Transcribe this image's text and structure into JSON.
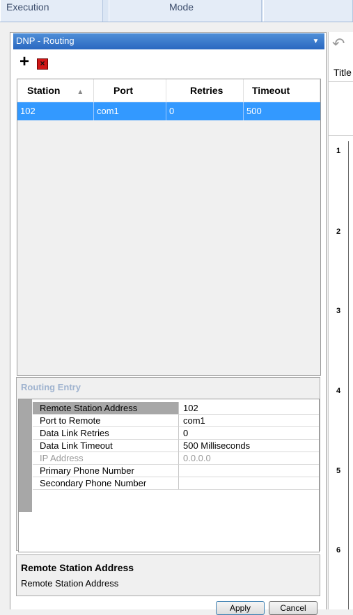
{
  "top_tabs": [
    "Execution",
    "Mode",
    ""
  ],
  "panel": {
    "title": "DNP - Routing",
    "add_label": "+",
    "delete_label": "×"
  },
  "grid": {
    "columns": [
      "Station",
      "Port",
      "Retries",
      "Timeout"
    ],
    "sort_indicator": "▲",
    "rows": [
      [
        "102",
        "com1",
        "0",
        "500"
      ]
    ]
  },
  "entry": {
    "title": "Routing Entry",
    "properties": [
      {
        "name": "Remote Station Address",
        "value": "102"
      },
      {
        "name": "Port to Remote",
        "value": "com1"
      },
      {
        "name": "Data Link Retries",
        "value": "0"
      },
      {
        "name": "Data Link Timeout",
        "value": "500 Milliseconds"
      },
      {
        "name": "IP Address",
        "value": "0.0.0.0"
      },
      {
        "name": "Primary Phone Number",
        "value": ""
      },
      {
        "name": "Secondary Phone Number",
        "value": ""
      }
    ]
  },
  "description": {
    "title": "Remote Station Address",
    "text": "Remote Station Address"
  },
  "buttons": {
    "apply": "Apply",
    "cancel": "Cancel"
  },
  "right": {
    "title": "Title",
    "row_numbers": [
      "1",
      "2",
      "3",
      "4",
      "5",
      "6"
    ]
  },
  "colors": {
    "selection": "#3399ff",
    "header_blue": "#2a68c0"
  },
  "icons": {
    "undo": "undo-icon",
    "dropdown": "chevron-down-icon",
    "delete": "close-icon",
    "add": "plus-icon"
  }
}
